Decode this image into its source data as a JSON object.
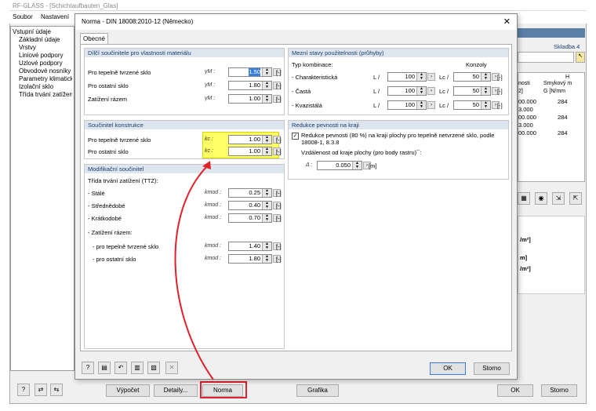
{
  "app": {
    "title": "RF-GLASS - [Schichtaufbauten_Glas]",
    "menu": [
      "Soubor",
      "Nastavení"
    ],
    "tree": {
      "root": "Vstupní údaje",
      "items": [
        "Základní údaje",
        "Vrstvy",
        "Liniové podpory",
        "Uzlové podpory",
        "Obvodové nosníky",
        "Parametry klimatické",
        "Izolační sklo",
        "Třída trvání zatížení"
      ]
    },
    "right": {
      "skladba": "Skladba 4",
      "col_h": "H",
      "col_nosti": "nosti",
      "col_smyk": "Smykový m",
      "col_g": "G [N/mm",
      "col_unit": "2]",
      "rows": [
        [
          "00.000",
          "284"
        ],
        [
          "3.000",
          ""
        ],
        [
          "00.000",
          "284"
        ],
        [
          "3.000",
          ""
        ],
        [
          "00.000",
          "284"
        ]
      ],
      "m1": "/m²]",
      "m2": "m]",
      "m3": "/m²]"
    },
    "bottom": {
      "vypocet": "Výpočet",
      "detaily": "Detaily...",
      "norma": "Norma",
      "grafika": "Grafika",
      "ok": "OK",
      "storno": "Storno"
    }
  },
  "dialog": {
    "title": "Norma - DIN 18008:2010-12 (Německo)",
    "tab": "Obecné",
    "g1": {
      "title": "Dílčí součinitele pro vlastnosti materiálu",
      "rows": [
        {
          "label": "Pro tepelně tvrzené sklo",
          "sym": "γM :",
          "value": "1.50",
          "ex": "[-]"
        },
        {
          "label": "Pro ostatní sklo",
          "sym": "γM :",
          "value": "1.80",
          "ex": "[-]"
        },
        {
          "label": "Zatížení rázem",
          "sym": "γM :",
          "value": "1.00",
          "ex": "[-]"
        }
      ]
    },
    "g2": {
      "title": "Součinitel konstrukce",
      "rows": [
        {
          "label": "Pro tepelně tvrzené sklo",
          "sym": "kc :",
          "value": "1.00",
          "ex": "[-]"
        },
        {
          "label": "Pro ostatní sklo",
          "sym": "kc :",
          "value": "1.00",
          "ex": "[-]"
        }
      ]
    },
    "g3": {
      "title": "Modifikační součinitel",
      "subtitle": "Třída trvání zatížení (TTZ):",
      "rows": [
        {
          "label": "- Stálé",
          "sym": "kmod :",
          "value": "0.25",
          "ex": "[-]"
        },
        {
          "label": "- Střednědobé",
          "sym": "kmod :",
          "value": "0.40",
          "ex": "[-]"
        },
        {
          "label": "- Krátkodobé",
          "sym": "kmod :",
          "value": "0.70",
          "ex": "[-]"
        }
      ],
      "impact": "- Zatížení rázem:",
      "rows2": [
        {
          "label": "- pro tepelně tvrzené sklo",
          "sym": "kmod :",
          "value": "1.40",
          "ex": "[-]"
        },
        {
          "label": "- pro ostatní sklo",
          "sym": "kmod :",
          "value": "1.80",
          "ex": "[-]"
        }
      ]
    },
    "g4": {
      "title": "Mezní stavy použitelnosti (průhyby)",
      "typ": "Typ kombinace:",
      "konzoly": "Konzoly",
      "rows": [
        {
          "label": "- Charakteristická",
          "l1": "L /",
          "v1": "100",
          "l2": "Lc /",
          "v2": "50",
          "ex": "[-]"
        },
        {
          "label": "- Častá",
          "l1": "L /",
          "v1": "100",
          "l2": "Lc /",
          "v2": "50",
          "ex": "[-]"
        },
        {
          "label": "- Kvazistálá",
          "l1": "L /",
          "v1": "100",
          "l2": "Lc /",
          "v2": "50",
          "ex": "[-]"
        }
      ]
    },
    "g5": {
      "title": "Redukce pevnosti na kraji",
      "check": "Redukce pevnosti (80 %) na kraji plochy pro tepelně netvrzené sklo, podle 18008-1, 8.3.8",
      "dist": "Vzdálenost od kraje plochy (pro body rastru)¯:",
      "sym": "Δ :",
      "value": "0.050",
      "unit": "[m]"
    },
    "ok": "OK",
    "storno": "Storno"
  },
  "colors": {
    "highlight": "#ffff66",
    "arrow": "#e0202a",
    "group_header": "#dde5ef"
  }
}
